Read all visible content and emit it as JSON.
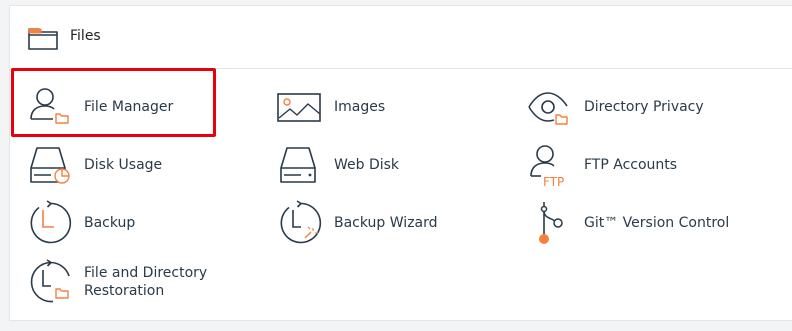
{
  "section": {
    "title": "Files",
    "icon": "folder-icon"
  },
  "items": [
    {
      "label": "File Manager",
      "icon": "file-manager-icon"
    },
    {
      "label": "Images",
      "icon": "images-icon"
    },
    {
      "label": "Directory Privacy",
      "icon": "directory-privacy-icon"
    },
    {
      "label": "Disk Usage",
      "icon": "disk-usage-icon"
    },
    {
      "label": "Web Disk",
      "icon": "web-disk-icon"
    },
    {
      "label": "FTP Accounts",
      "icon": "ftp-accounts-icon"
    },
    {
      "label": "Backup",
      "icon": "backup-icon"
    },
    {
      "label": "Backup Wizard",
      "icon": "backup-wizard-icon"
    },
    {
      "label": "Git™ Version Control",
      "icon": "git-version-control-icon"
    },
    {
      "label": "File and Directory Restoration",
      "icon": "file-directory-restoration-icon"
    }
  ],
  "icon_text": {
    "ftp": "FTP"
  },
  "colors": {
    "accent_orange": "#f5813f",
    "icon_stroke": "#293a4a",
    "label_text": "#293a4a",
    "highlight_border": "#e8000d"
  },
  "highlighted_item": "File Manager"
}
